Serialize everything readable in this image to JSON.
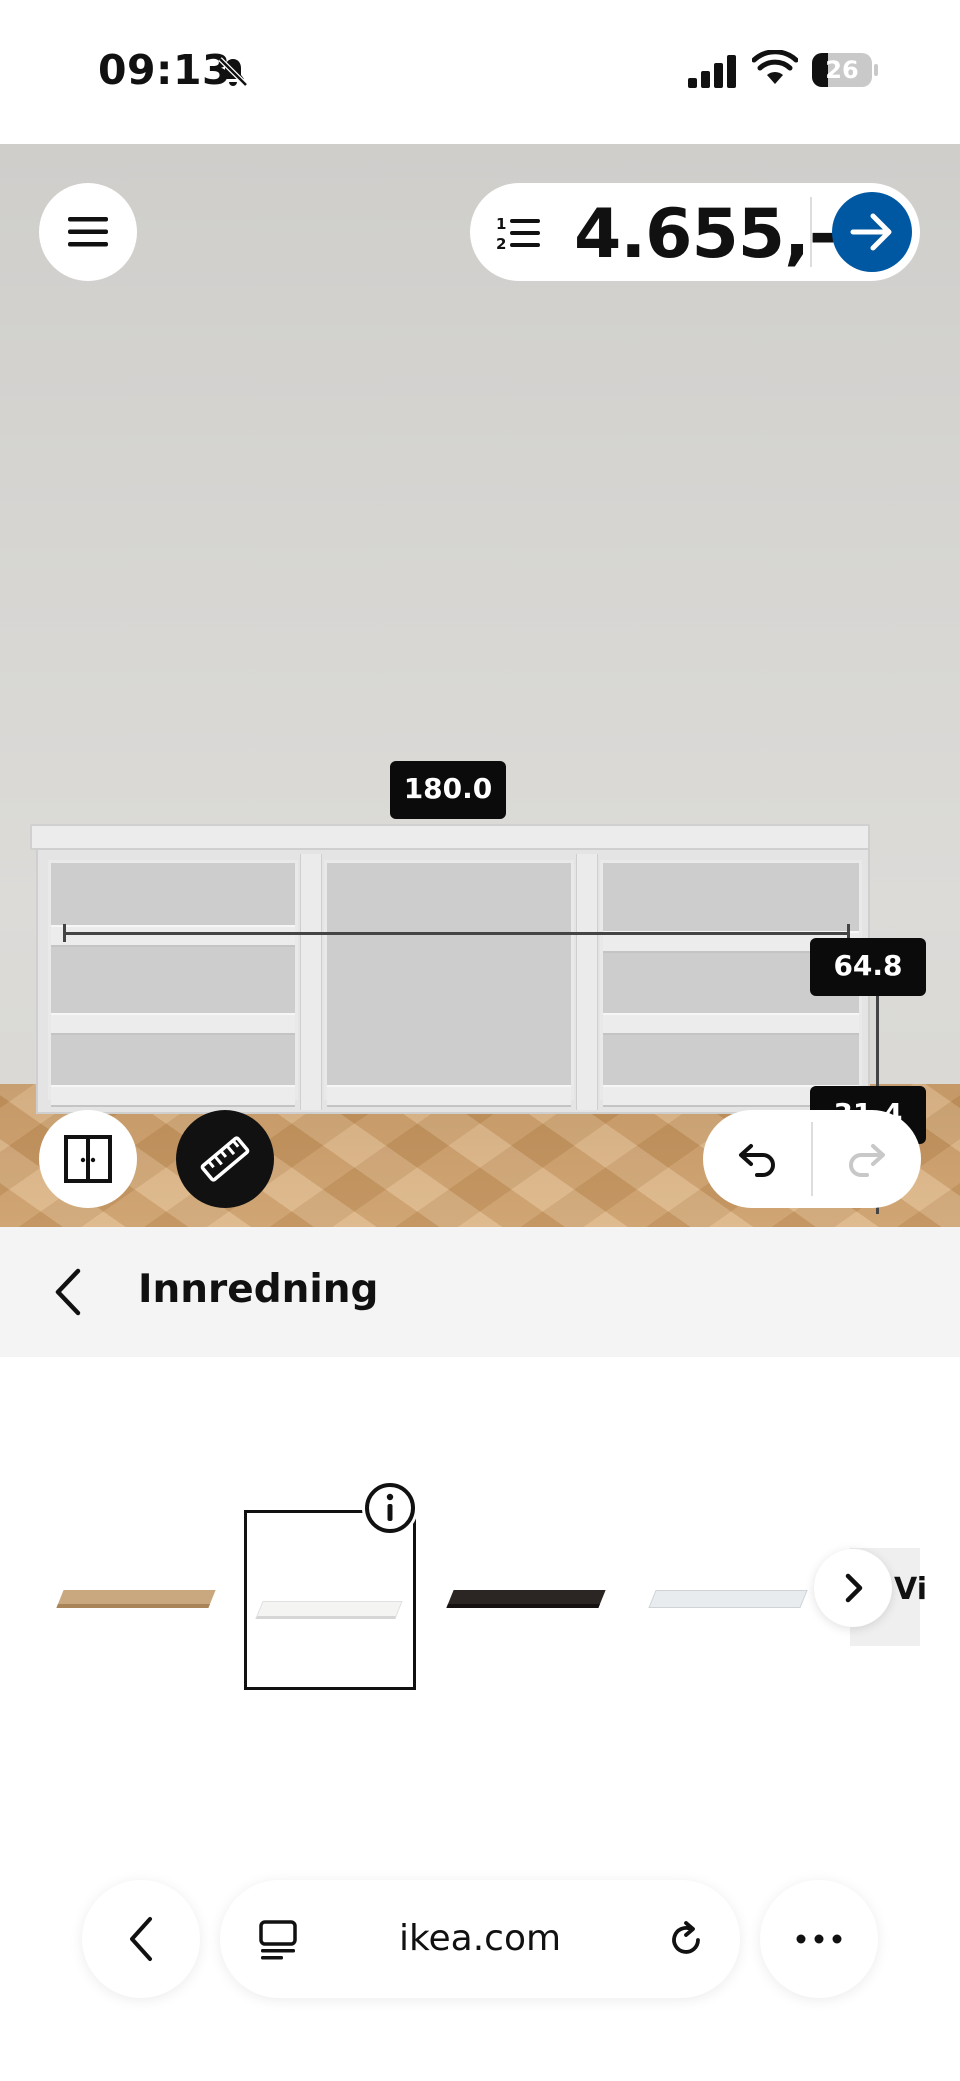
{
  "status_bar": {
    "time": "09:13",
    "battery": "26",
    "battery_level": 0.26
  },
  "planner": {
    "price": "4.655,-",
    "dimensions": {
      "width": "180.0",
      "height": "64.8",
      "depth": "31.4"
    }
  },
  "section": {
    "title": "Innredning"
  },
  "carousel": {
    "swatches": [
      {
        "color": "#c9a77f"
      },
      {
        "color": "#f4f4f2"
      },
      {
        "color": "#2b2523"
      },
      {
        "color": "#e9ecee"
      }
    ],
    "more_label": "Vi"
  },
  "browser": {
    "url": "ikea.com"
  },
  "colors": {
    "accent": "#0058a3"
  }
}
